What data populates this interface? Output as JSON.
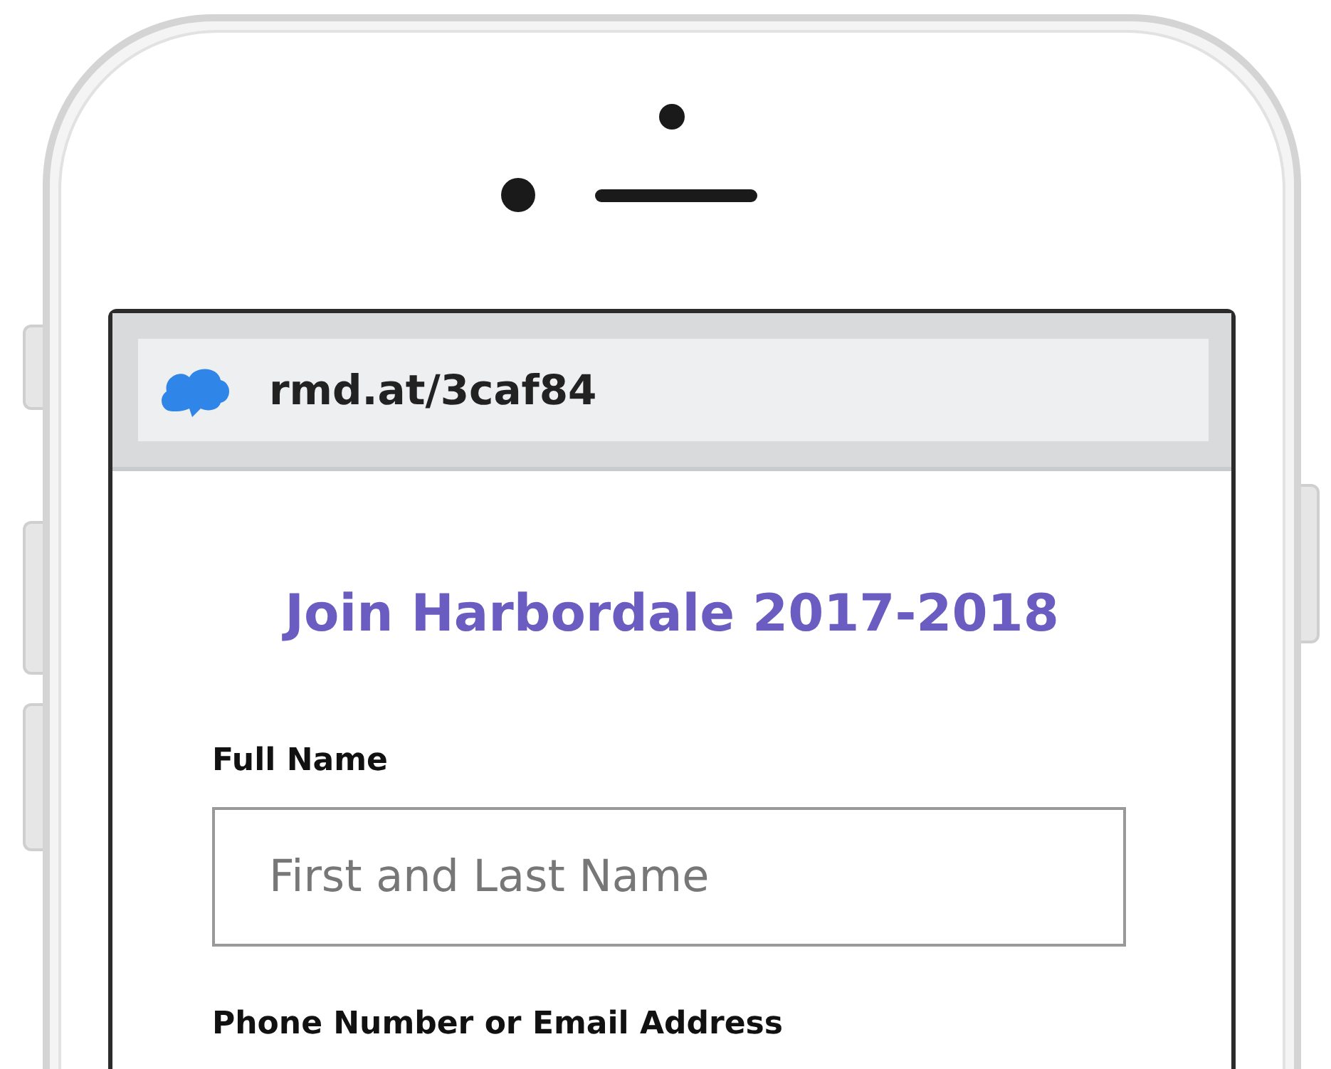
{
  "browser": {
    "url": "rmd.at/3caf84"
  },
  "form": {
    "title": "Join Harbordale 2017-2018",
    "fields": [
      {
        "label": "Full Name",
        "placeholder": "First and Last Name"
      },
      {
        "label": "Phone Number or Email Address"
      }
    ]
  }
}
